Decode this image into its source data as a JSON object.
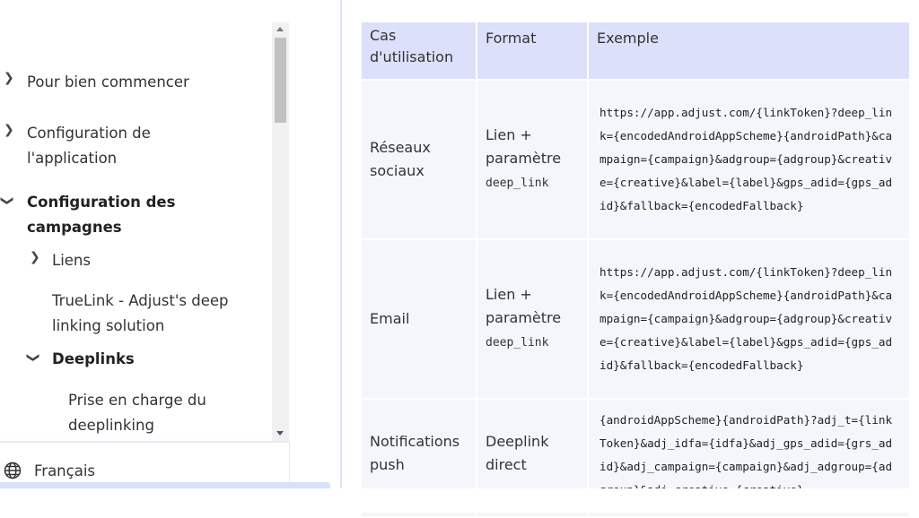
{
  "sidebar": {
    "items": [
      {
        "label": "Pour bien commencer",
        "expanded": false
      },
      {
        "label": "Configuration de l'application",
        "expanded": false
      },
      {
        "label": "Configuration des campagnes",
        "expanded": true
      },
      {
        "label": "Liens",
        "expanded": false
      },
      {
        "label": "TrueLink - Adjust's deep linking solution"
      },
      {
        "label": "Deeplinks",
        "expanded": true
      },
      {
        "label": "Prise en charge du deeplinking"
      }
    ],
    "language": "Français"
  },
  "table": {
    "headers": [
      "Cas d'utilisation",
      "Format",
      "Exemple"
    ],
    "rows": [
      {
        "use_case": "Réseaux sociaux",
        "format_text": "Lien + paramètre ",
        "format_code": "deep_link",
        "example": "https://app.adjust.com/{linkToken}?deep_link={encodedAndroidAppScheme}{androidPath}&campaign={campaign}&adgroup={adgroup}&creative={creative}&label={label}&gps_adid={gps_adid}&fallback={encodedFallback}"
      },
      {
        "use_case": "Email",
        "format_text": "Lien + paramètre ",
        "format_code": "deep_link",
        "example": "https://app.adjust.com/{linkToken}?deep_link={encodedAndroidAppScheme}{androidPath}&campaign={campaign}&adgroup={adgroup}&creative={creative}&label={label}&gps_adid={gps_adid}&fallback={encodedFallback}"
      },
      {
        "use_case": "Notifications push",
        "format_text": "Deeplink direct",
        "format_code": "",
        "example": "{androidAppScheme}{androidPath}?adj_t={linkToken}&adj_idfa={idfa}&adj_gps_adid={grs_adid}&adj_campaign={campaign}&adj_adgroup={adgroup}&adj_creative={creative}"
      }
    ]
  }
}
